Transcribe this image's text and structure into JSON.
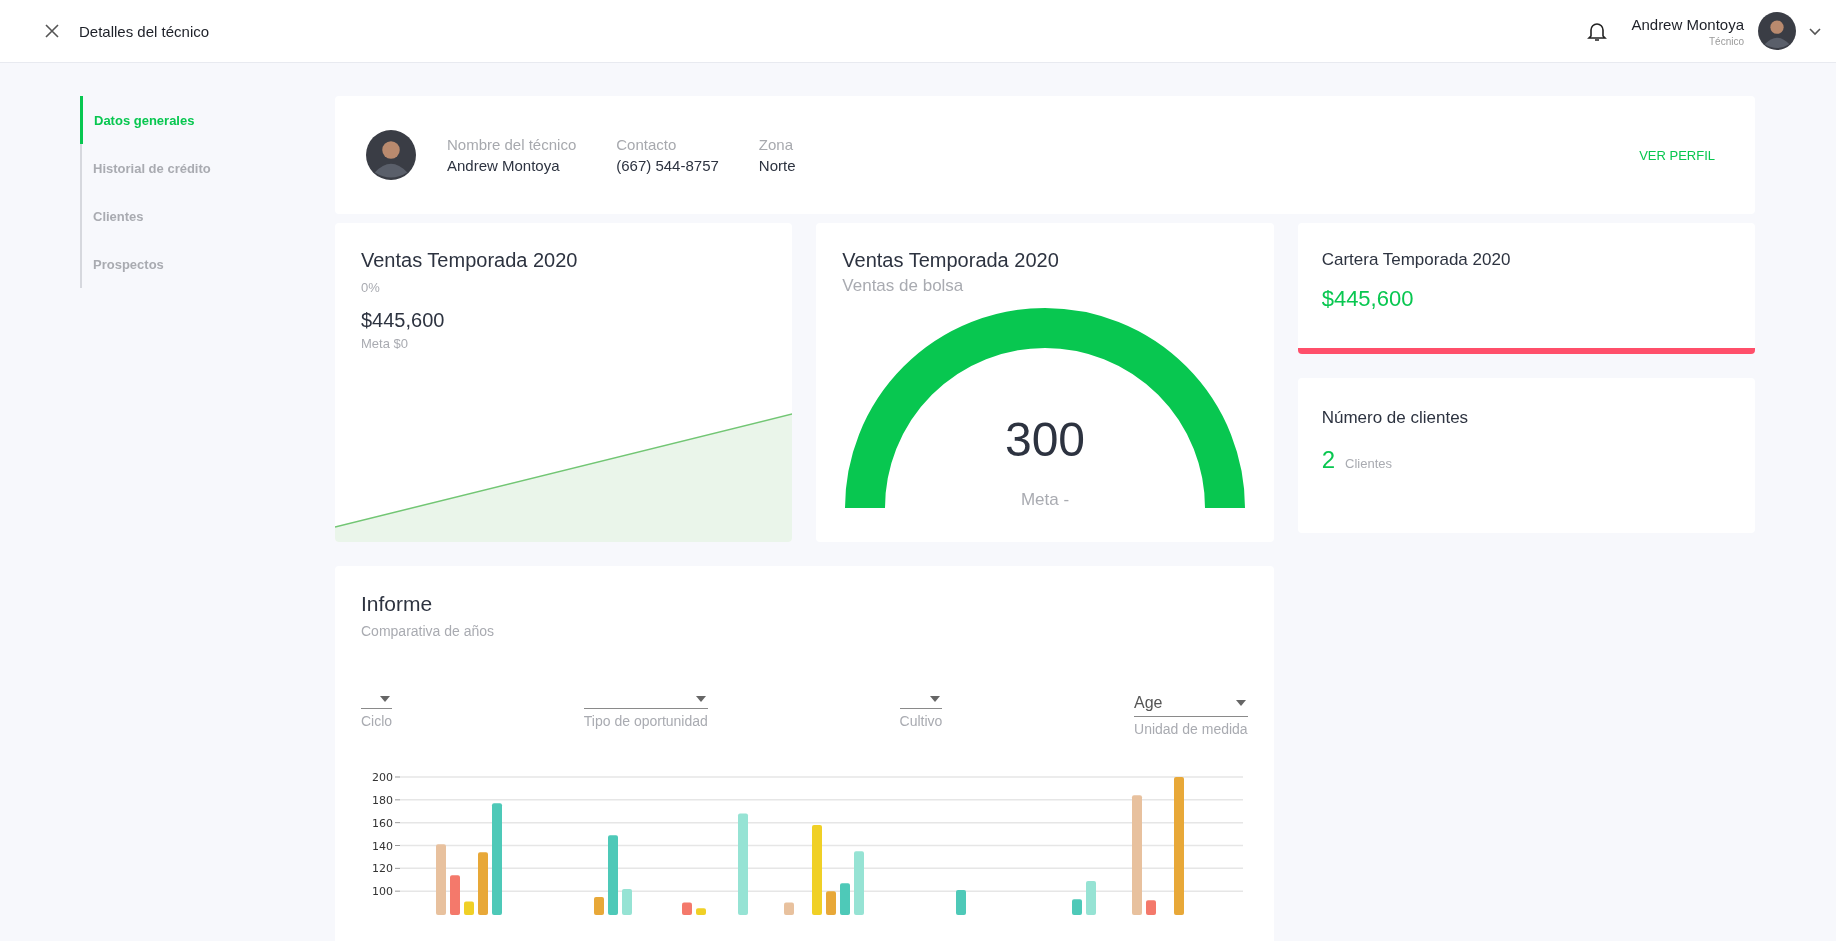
{
  "header": {
    "title": "Detalles del técnico",
    "user": {
      "name": "Andrew Montoya",
      "role": "Técnico"
    }
  },
  "sidebar": {
    "items": [
      {
        "label": "Datos generales",
        "selected": true
      },
      {
        "label": "Historial de crédito",
        "selected": false
      },
      {
        "label": "Clientes",
        "selected": false
      },
      {
        "label": "Prospectos",
        "selected": false
      }
    ]
  },
  "profile": {
    "fields": [
      {
        "label": "Nombre del técnico",
        "value": "Andrew Montoya"
      },
      {
        "label": "Contacto",
        "value": "(667) 544-8757"
      },
      {
        "label": "Zona",
        "value": "Norte"
      }
    ],
    "action": "VER PERFIL"
  },
  "sales_card": {
    "title": "Ventas Temporada 2020",
    "percent": "0%",
    "amount": "$445,600",
    "goal": "Meta $0"
  },
  "gauge_card": {
    "title": "Ventas Temporada 2020",
    "subtitle": "Ventas de bolsa",
    "value": "300",
    "goal": "Meta -"
  },
  "portfolio_card": {
    "title": "Cartera Temporada 2020",
    "amount": "$445,600"
  },
  "clients_card": {
    "title": "Número de clientes",
    "count": "2",
    "unit": "Clientes"
  },
  "report": {
    "title": "Informe",
    "subtitle": "Comparativa de años",
    "filters": [
      {
        "label": "Ciclo"
      },
      {
        "label": "Tipo de oportunidad"
      },
      {
        "label": "Cultivo"
      },
      {
        "label": "Unidad de medida",
        "value": "Age"
      }
    ],
    "chart_data": {
      "type": "bar",
      "grid": true,
      "ylim": [
        80,
        200
      ],
      "yticks": [
        100,
        120,
        140,
        160,
        180,
        200
      ],
      "series": [
        {
          "color": "#e8c19e",
          "values": [
            141,
            null,
            null,
            90,
            null,
            null,
            184
          ]
        },
        {
          "color": "#f4796b",
          "values": [
            114,
            null,
            90,
            null,
            null,
            null,
            92
          ]
        },
        {
          "color": "#f0d026",
          "values": [
            91,
            null,
            85,
            158,
            null,
            null,
            null
          ]
        },
        {
          "color": "#e8a838",
          "values": [
            134,
            95,
            null,
            100,
            null,
            null,
            200
          ]
        },
        {
          "color": "#4ec9b8",
          "values": [
            177,
            149,
            null,
            107,
            101,
            93,
            null
          ]
        },
        {
          "color": "#96e3d4",
          "values": [
            null,
            102,
            168,
            135,
            null,
            109,
            null
          ]
        }
      ]
    }
  }
}
